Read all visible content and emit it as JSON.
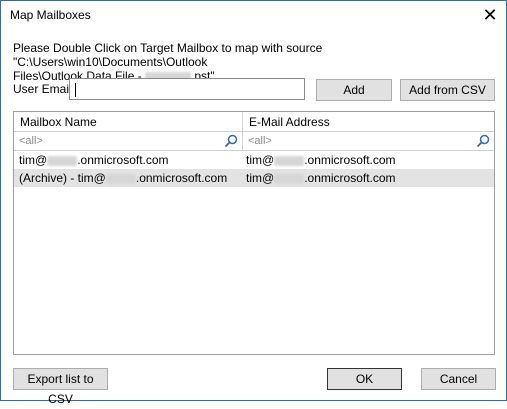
{
  "window": {
    "title": "Map Mailboxes"
  },
  "instructions": {
    "line1": "Please Double Click on Target Mailbox to map with source \"C:\\Users\\win10\\Documents\\Outlook",
    "line2_prefix": "Files\\Outlook Data File - ",
    "line2_suffix": ".pst\"."
  },
  "user_email": {
    "label": "User Email",
    "value": ""
  },
  "buttons": {
    "add": "Add",
    "add_from_csv": "Add from CSV",
    "export": "Export list to CSV",
    "ok": "OK",
    "cancel": "Cancel"
  },
  "table": {
    "columns": [
      "Mailbox Name",
      "E-Mail Address"
    ],
    "filter_placeholder": "<all>",
    "rows": [
      {
        "name_prefix": "tim@",
        "name_suffix": ".onmicrosoft.com",
        "email_prefix": "tim@",
        "email_suffix": ".onmicrosoft.com"
      },
      {
        "name_prefix": "(Archive) - tim@",
        "name_suffix": ".onmicrosoft.com",
        "email_prefix": "tim@",
        "email_suffix": ".onmicrosoft.com"
      }
    ]
  }
}
